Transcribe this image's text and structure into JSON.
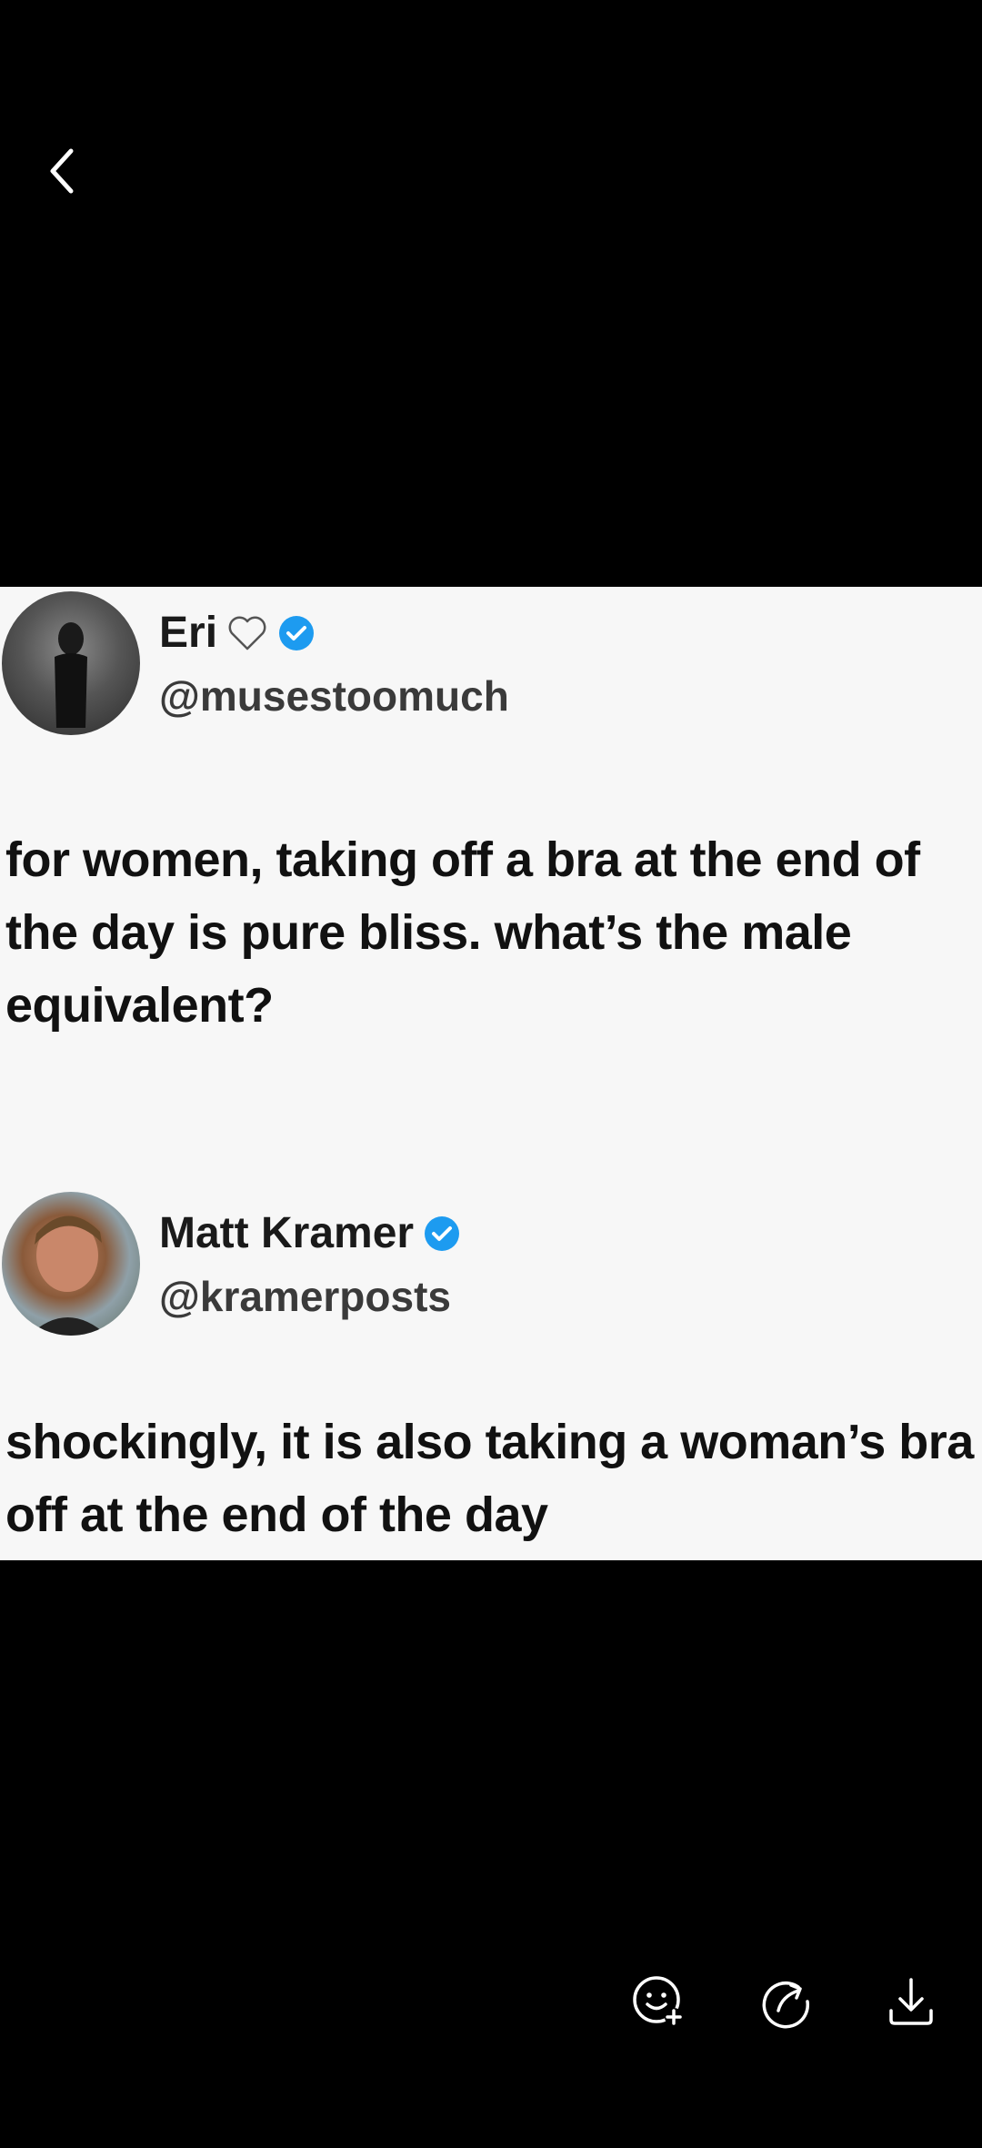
{
  "nav": {
    "back_icon": "chevron-left-icon"
  },
  "tweets": [
    {
      "display_name": "Eri",
      "name_emoji": "heart-outline-icon",
      "verified": true,
      "handle": "@musestoomuch",
      "text": "for women, taking off a bra at the end of the day is pure bliss. what’s the male equivalent?"
    },
    {
      "display_name": "Matt Kramer",
      "verified": true,
      "handle": "@kramerposts",
      "text": "shockingly, it is also taking a woman’s bra off at the end of the day"
    }
  ],
  "actions": [
    {
      "icon": "emoji-add-icon"
    },
    {
      "icon": "share-icon"
    },
    {
      "icon": "download-icon"
    }
  ],
  "colors": {
    "background": "#000000",
    "verified": "#1d9bf0",
    "icons": "#ffffff"
  }
}
